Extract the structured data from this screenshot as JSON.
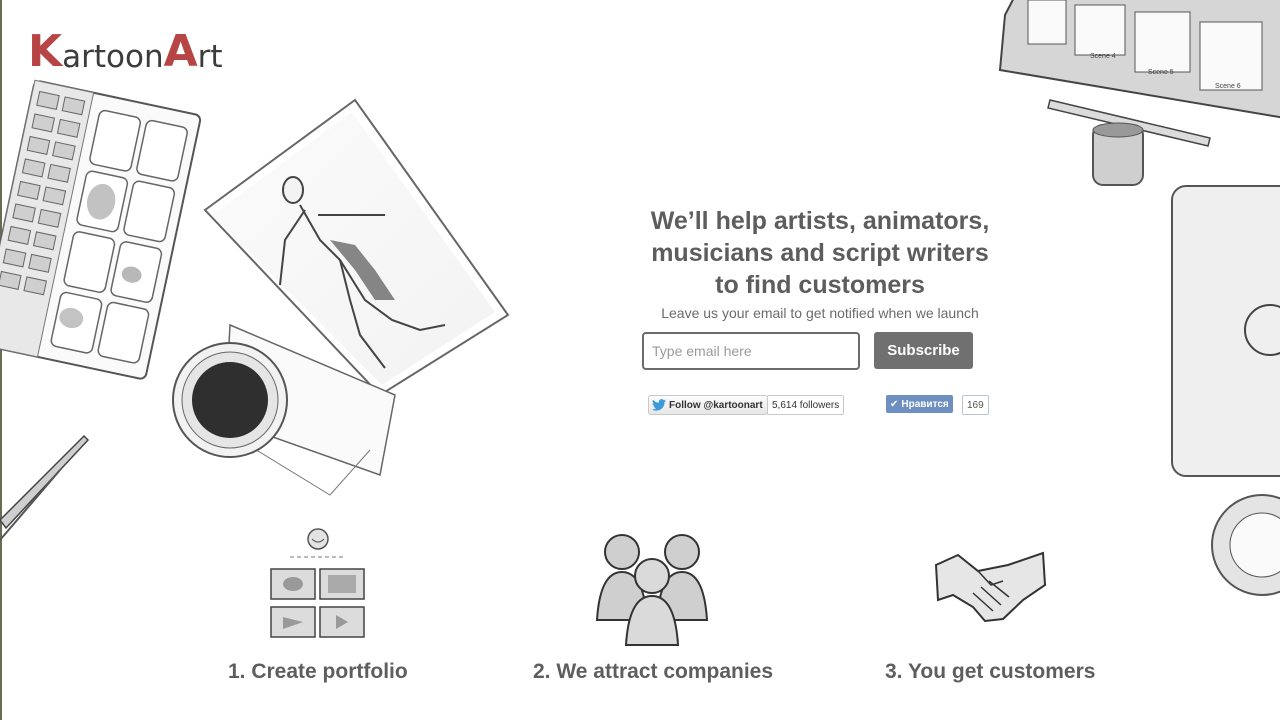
{
  "brand": {
    "logo_big_k": "K",
    "logo_part1": "artoon",
    "logo_big_a": "A",
    "logo_part2": "rt",
    "accent_color": "#b84545"
  },
  "hero": {
    "headline_line1": "We’ll help artists, animators,",
    "headline_line2": "musicians and script writers",
    "headline_line3": "to find customers",
    "subline": "Leave us your email to get notified when we launch"
  },
  "signup": {
    "email_placeholder": "Type email here",
    "email_value": "",
    "subscribe_label": "Subscribe"
  },
  "social": {
    "twitter_follow_label": "Follow @kartoonart",
    "twitter_followers": "5,614 followers",
    "vk_like_label": "Нравится",
    "vk_like_count": "169"
  },
  "sketch_text": {
    "scene4": "Scene 4",
    "scene5": "Scene 5",
    "scene6": "Scene 6"
  },
  "steps": [
    {
      "label": "1. Create portfolio",
      "icon": "portfolio-icon"
    },
    {
      "label": "2. We attract companies",
      "icon": "people-icon"
    },
    {
      "label": "3. You get customers",
      "icon": "handshake-icon"
    }
  ]
}
